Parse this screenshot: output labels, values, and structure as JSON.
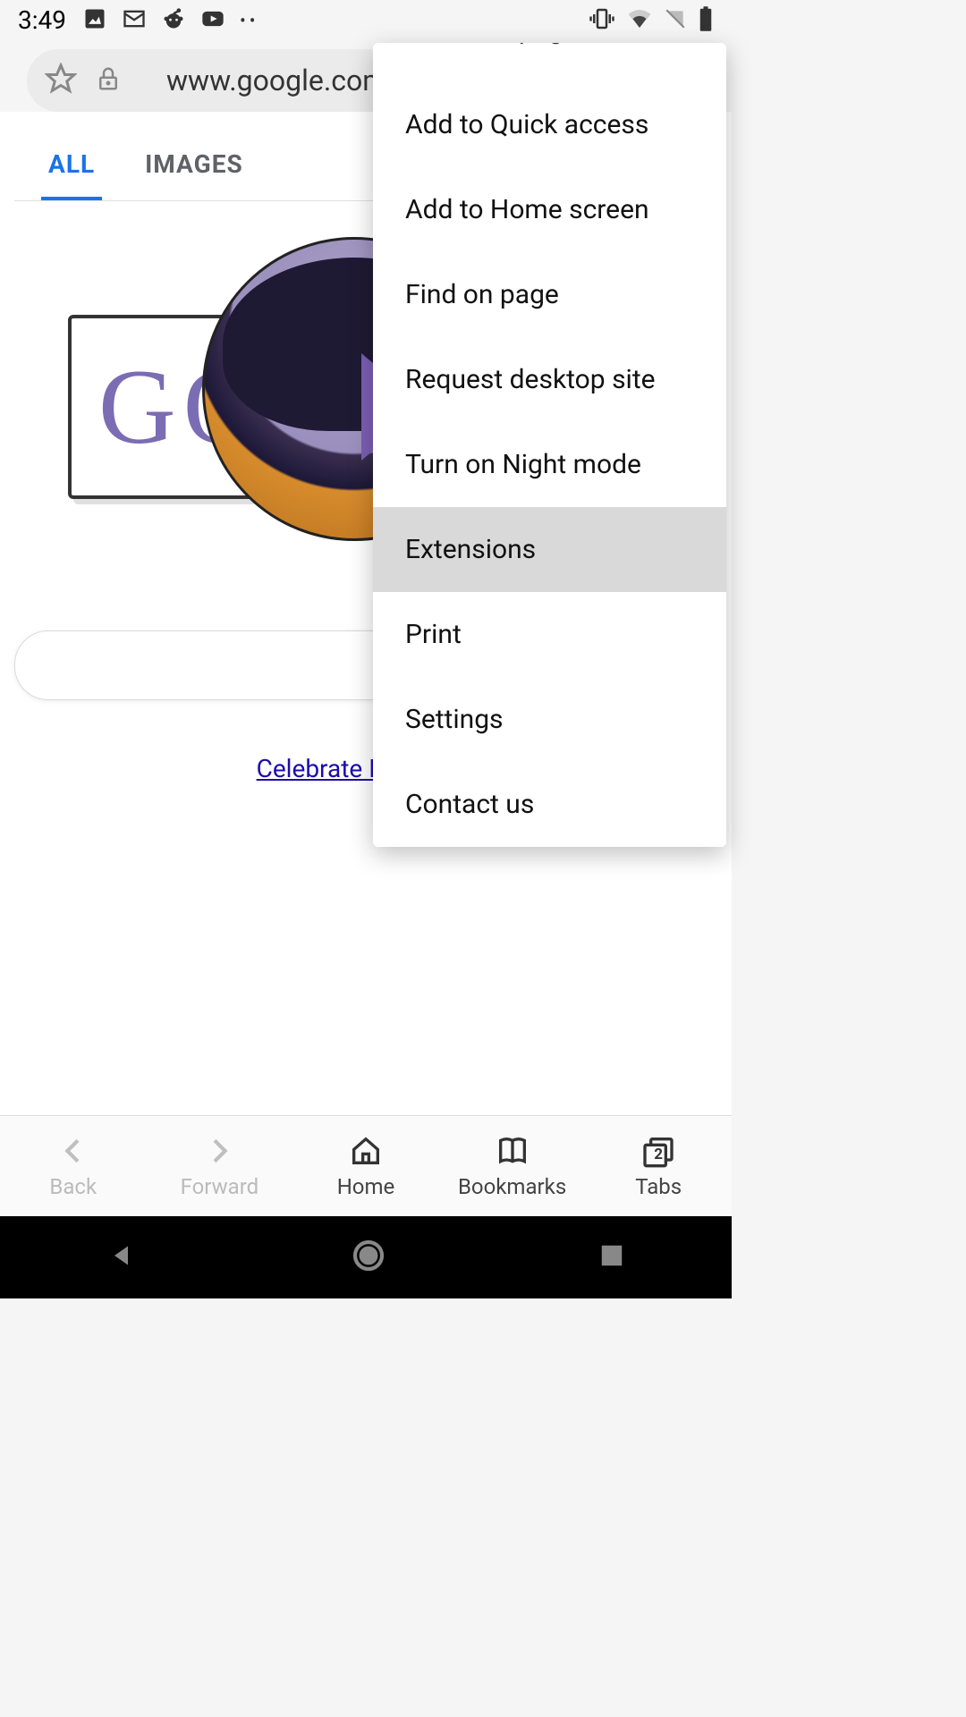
{
  "status": {
    "time": "3:49",
    "icons_left": [
      "photo-icon",
      "gmail-icon",
      "reddit-icon",
      "youtube-icon",
      "more-dots-icon"
    ],
    "icons_right": [
      "vibrate-icon",
      "wifi-icon",
      "no-sim-icon",
      "battery-icon"
    ]
  },
  "address_bar": {
    "url": "www.google.com"
  },
  "tabs": {
    "all": "ALL",
    "images": "IMAGES"
  },
  "doodle": {
    "text": "GO"
  },
  "celebrate": {
    "text": "Celebrate Internatio"
  },
  "menu": {
    "save_webpage": "Save webpage",
    "add_quick_access": "Add to Quick access",
    "add_home_screen": "Add to Home screen",
    "find_on_page": "Find on page",
    "request_desktop": "Request desktop site",
    "night_mode": "Turn on Night mode",
    "extensions": "Extensions",
    "print": "Print",
    "settings": "Settings",
    "contact_us": "Contact us"
  },
  "bottom_bar": {
    "back": "Back",
    "forward": "Forward",
    "home": "Home",
    "bookmarks": "Bookmarks",
    "tabs": "Tabs",
    "tabs_count": "2"
  }
}
